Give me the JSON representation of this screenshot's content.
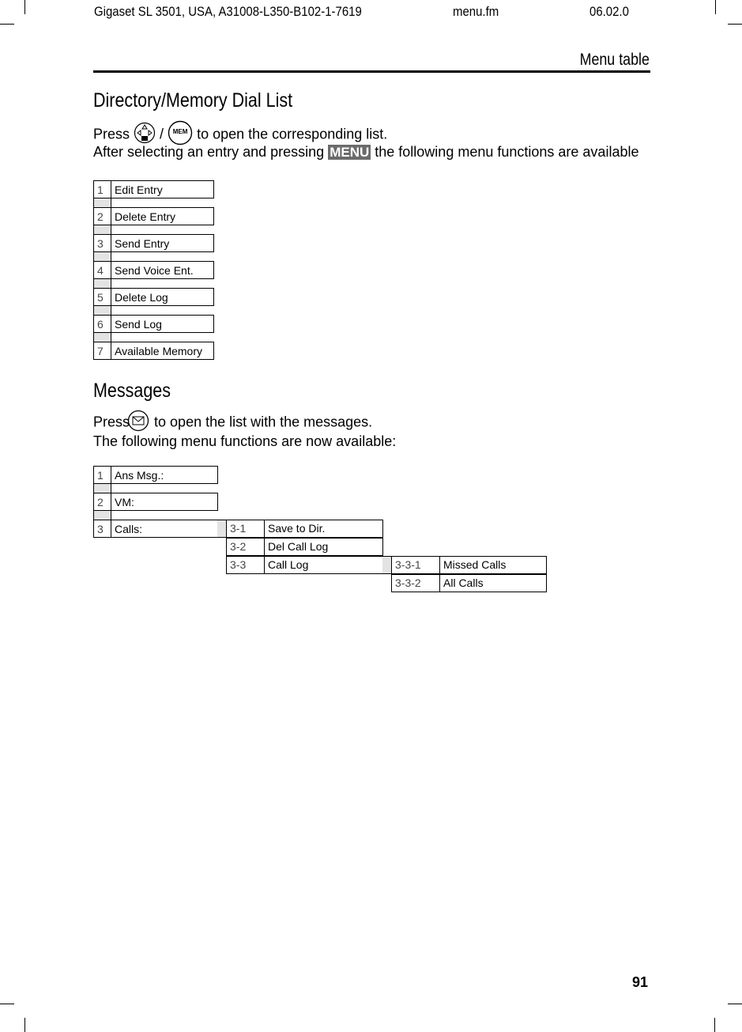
{
  "header": {
    "doc_id": "Gigaset SL 3501, USA, A31008-L350-B102-1-7619",
    "file": "menu.fm",
    "date": "06.02.0",
    "running_title": "Menu table"
  },
  "sections": {
    "directory": {
      "title": "Directory/Memory Dial List",
      "line1_press": "Press",
      "line1_slash": "/",
      "line1_rest": "to open the corresponding list.",
      "nav_key_icon": "navigation-key-down",
      "mem_key_label": "MEM",
      "line2_before": "After selecting an entry and pressing",
      "line2_key": "MENU",
      "line2_after": "the following menu functions are available",
      "items": [
        {
          "num": "1",
          "label": "Edit Entry"
        },
        {
          "num": "2",
          "label": "Delete Entry"
        },
        {
          "num": "3",
          "label": "Send Entry"
        },
        {
          "num": "4",
          "label": "Send Voice Ent."
        },
        {
          "num": "5",
          "label": "Delete Log"
        },
        {
          "num": "6",
          "label": "Send Log"
        },
        {
          "num": "7",
          "label": "Available Memory"
        }
      ]
    },
    "messages": {
      "title": "Messages",
      "line1_press": "Press",
      "envelope_icon": "envelope-key",
      "line1_rest": "to open the list with the messages.",
      "line2": "The following menu functions are now available:",
      "items": [
        {
          "num": "1",
          "label": "Ans Msg.:"
        },
        {
          "num": "2",
          "label": "VM:"
        },
        {
          "num": "3",
          "label": "Calls:"
        }
      ],
      "calls_submenu": [
        {
          "num": "3-1",
          "label": "Save to Dir."
        },
        {
          "num": "3-2",
          "label": "Del Call Log"
        },
        {
          "num": "3-3",
          "label": "Call Log"
        }
      ],
      "call_log_submenu": [
        {
          "num": "3-3-1",
          "label": "Missed Calls"
        },
        {
          "num": "3-3-2",
          "label": "All Calls"
        }
      ]
    }
  },
  "footer": {
    "page_number": "91"
  }
}
